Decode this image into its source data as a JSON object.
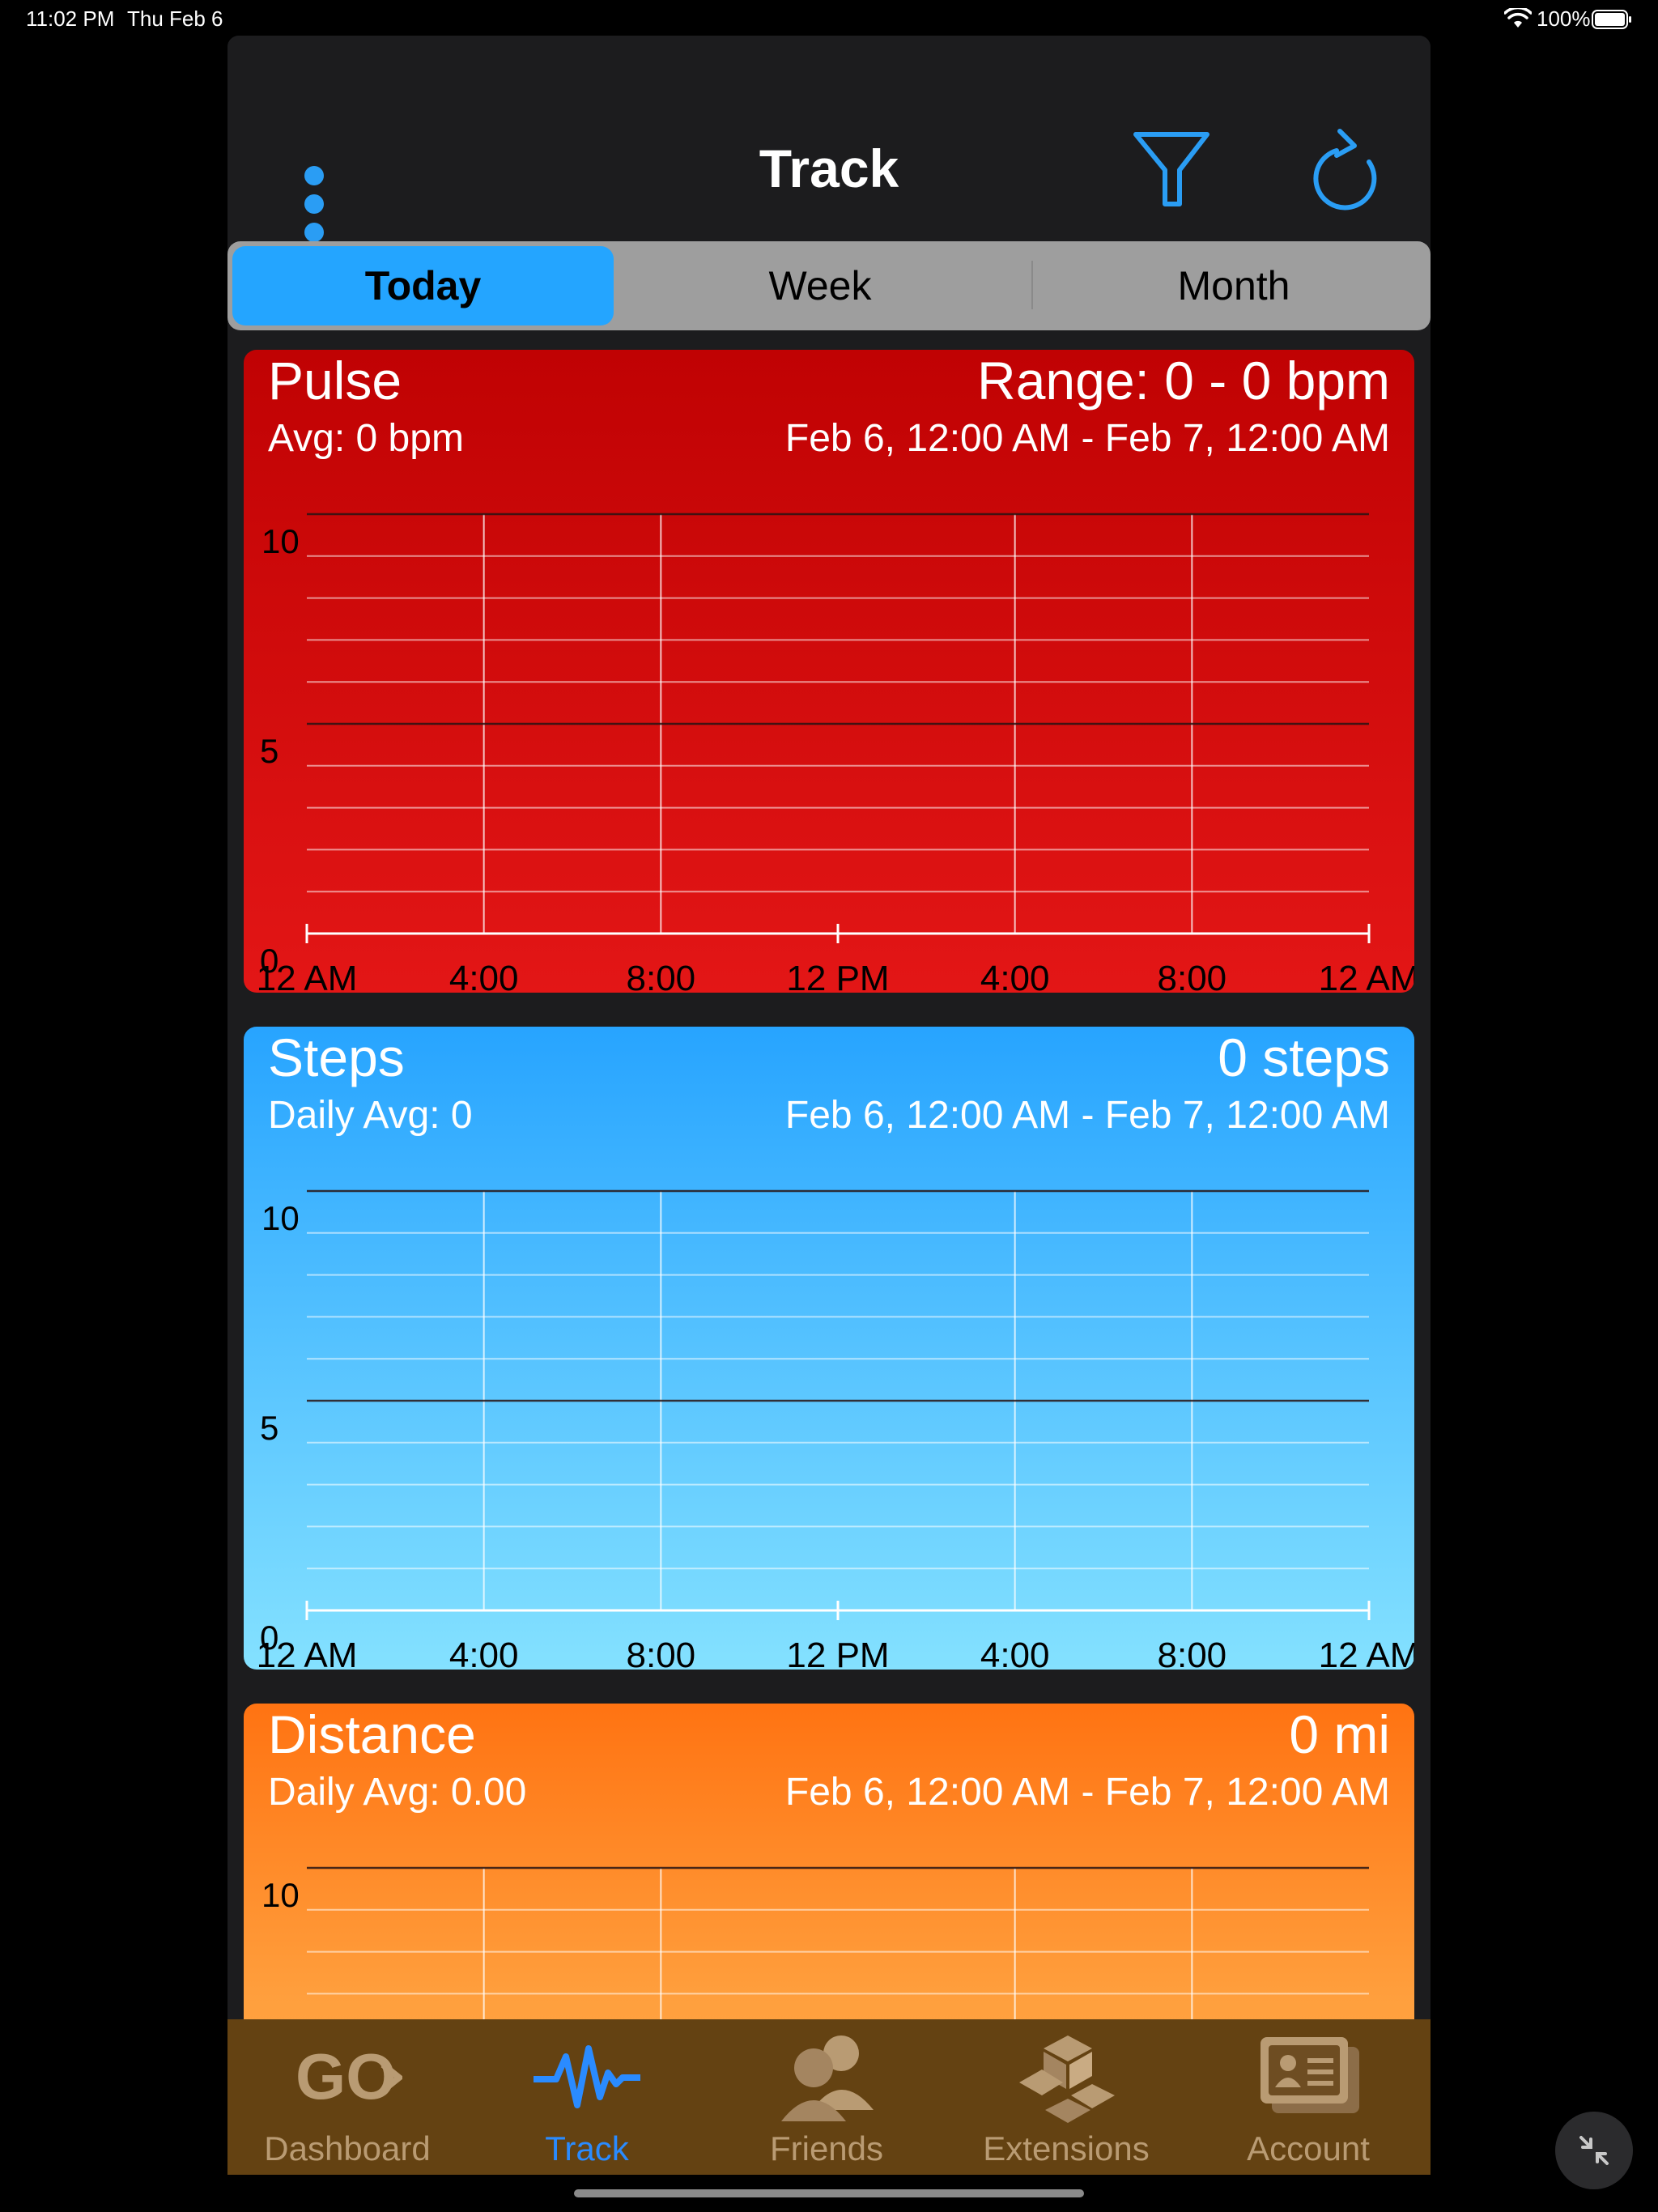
{
  "status": {
    "time": "11:02 PM",
    "date": "Thu Feb 6",
    "battery": "100%"
  },
  "nav": {
    "title": "Track"
  },
  "segments": [
    "Today",
    "Week",
    "Month"
  ],
  "cards": [
    {
      "title": "Pulse",
      "summary": "Range: 0 - 0 bpm",
      "avg": "Avg: 0 bpm",
      "range": "Feb 6, 12:00 AM - Feb 7, 12:00 AM"
    },
    {
      "title": "Steps",
      "summary": "0 steps",
      "avg": "Daily Avg: 0",
      "range": "Feb 6, 12:00 AM - Feb 7, 12:00 AM"
    },
    {
      "title": "Distance",
      "summary": "0 mi",
      "avg": "Daily Avg: 0.00",
      "range": "Feb 6, 12:00 AM - Feb 7, 12:00 AM"
    }
  ],
  "chart_data": [
    {
      "type": "line",
      "ylim": [
        0,
        10
      ],
      "yticks": [
        "0",
        "5",
        "10"
      ],
      "x": [
        "12 AM",
        "4:00",
        "8:00",
        "12 PM",
        "4:00",
        "8:00",
        "12 AM"
      ],
      "series": [],
      "grid": true
    },
    {
      "type": "line",
      "ylim": [
        0,
        10
      ],
      "yticks": [
        "0",
        "5",
        "10"
      ],
      "x": [
        "12 AM",
        "4:00",
        "8:00",
        "12 PM",
        "4:00",
        "8:00",
        "12 AM"
      ],
      "series": [],
      "grid": true
    },
    {
      "type": "line",
      "ylim": [
        0,
        10
      ],
      "yticks": [
        "10"
      ],
      "x": [],
      "series": [],
      "grid": true
    }
  ],
  "tabs": [
    {
      "label": "Dashboard",
      "icon": "go-logo-icon"
    },
    {
      "label": "Track",
      "icon": "pulse-wave-icon"
    },
    {
      "label": "Friends",
      "icon": "friends-icon"
    },
    {
      "label": "Extensions",
      "icon": "cubes-icon"
    },
    {
      "label": "Account",
      "icon": "account-card-icon"
    }
  ],
  "colors": {
    "accent": "#24a5ff",
    "pulse": "#d00a0a",
    "steps": "#3ab0ff",
    "distance": "#ff8420",
    "tabbar": "#644212"
  }
}
